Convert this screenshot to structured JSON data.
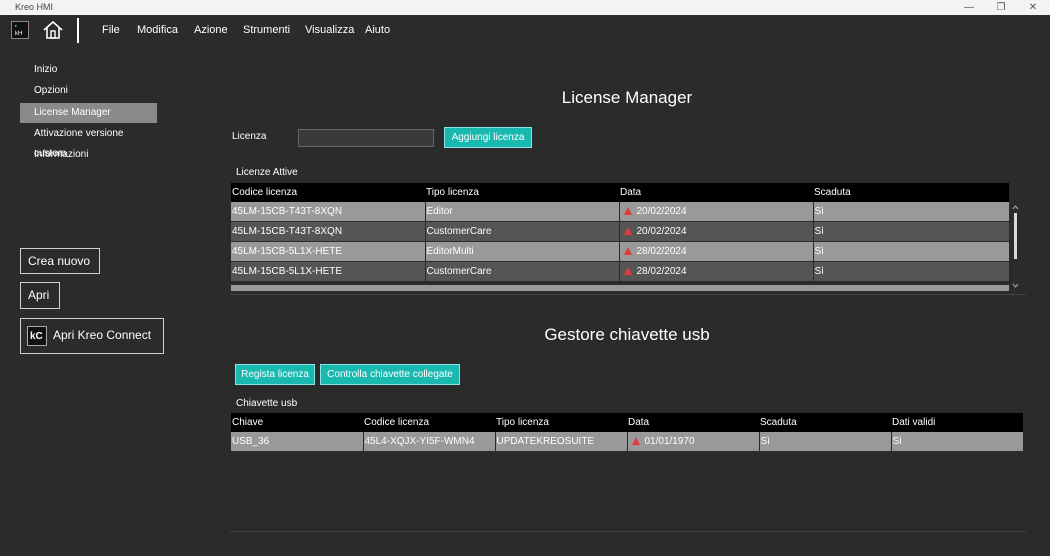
{
  "window": {
    "title": "Kreo HMI",
    "controls": [
      "—",
      "❐",
      "✕"
    ]
  },
  "menu": {
    "items": [
      "File",
      "Modifica",
      "Azione",
      "Strumenti",
      "Visualizza",
      "Aiuto"
    ]
  },
  "sidebar": {
    "items": [
      {
        "label": "Inizio"
      },
      {
        "label": "Opzioni"
      },
      {
        "label": "License Manager",
        "active": true
      },
      {
        "label": "Attivazione versione custom"
      },
      {
        "label": "Informazioni"
      }
    ],
    "crea_nuovo": "Crea nuovo",
    "apri": "Apri",
    "apri_kreo_connect": "Apri Kreo Connect",
    "kc_logo": "kC"
  },
  "license_manager": {
    "title": "License Manager",
    "licenza_label": "Licenza",
    "licenza_value": "",
    "aggiungi_button": "Aggiungi licenza",
    "section_label": "Licenze Attive",
    "columns": [
      "Codice licenza",
      "Tipo licenza",
      "Data",
      "Scaduta"
    ],
    "rows": [
      {
        "codice": "45LM-15CB-T43T-8XQN",
        "tipo": "Editor",
        "data": "20/02/2024",
        "scaduta": "Sì"
      },
      {
        "codice": "45LM-15CB-T43T-8XQN",
        "tipo": "CustomerCare",
        "data": "20/02/2024",
        "scaduta": "Sì"
      },
      {
        "codice": "45LM-15CB-5L1X-HETE",
        "tipo": "EditorMulti",
        "data": "28/02/2024",
        "scaduta": "Sì"
      },
      {
        "codice": "45LM-15CB-5L1X-HETE",
        "tipo": "CustomerCare",
        "data": "28/02/2024",
        "scaduta": "Sì"
      }
    ]
  },
  "usb": {
    "title": "Gestore chiavette usb",
    "registra_button": "Regista licenza",
    "controlla_button": "Controlla chiavette collegate",
    "section_label": "Chiavette usb",
    "columns": [
      "Chiave",
      "Codice licenza",
      "Tipo licenza",
      "Data",
      "Scaduta",
      "Dati validi"
    ],
    "rows": [
      {
        "chiave": "USB_36",
        "codice": "45L4-XQJX-YI5F-WMN4",
        "tipo": "UPDATEKREOSUITE",
        "data": "01/01/1970",
        "scaduta": "Sì",
        "validi": "Sì"
      }
    ]
  },
  "colors": {
    "accent": "#1ab9b0",
    "background": "#2b2b2b",
    "warning": "#e23b3b"
  }
}
